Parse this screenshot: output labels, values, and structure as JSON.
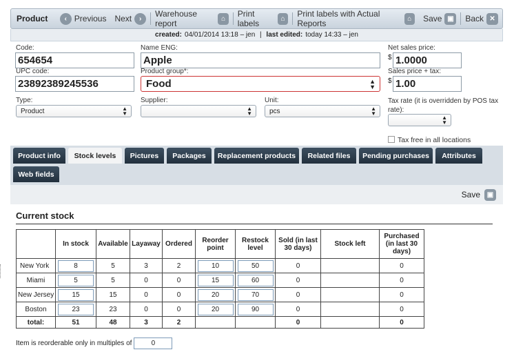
{
  "toolbar": {
    "title": "Product",
    "previous": "Previous",
    "next": "Next",
    "warehouse_report": "Warehouse report",
    "print_labels": "Print labels",
    "print_labels_actual": "Print labels with Actual Reports",
    "save": "Save",
    "back": "Back"
  },
  "meta": {
    "created_label": "created:",
    "created_value": "04/01/2014 13:18 – jen",
    "edited_label": "last edited:",
    "edited_value": "today 14:33 – jen"
  },
  "form": {
    "code_label": "Code:",
    "code_value": "654654",
    "upc_label": "UPC code:",
    "upc_value": "23892389245536",
    "name_label": "Name ENG:",
    "name_value": "Apple",
    "group_label": "Product group*:",
    "group_value": "Food",
    "net_label": "Net sales price:",
    "net_value": "1.0000",
    "gross_label": "Sales price + tax:",
    "gross_value": "1.00",
    "currency": "$",
    "type_label": "Type:",
    "type_value": "Product",
    "supplier_label": "Supplier:",
    "supplier_value": "",
    "unit_label": "Unit:",
    "unit_value": "pcs",
    "tax_label": "Tax rate (it is overridden by POS tax rate):",
    "tax_value": "",
    "taxfree_label": "Tax free in all locations"
  },
  "tabs": [
    {
      "label": "Product info"
    },
    {
      "label": "Stock levels"
    },
    {
      "label": "Pictures"
    },
    {
      "label": "Packages"
    },
    {
      "label": "Replacement products"
    },
    {
      "label": "Related files"
    },
    {
      "label": "Pending purchases"
    },
    {
      "label": "Attributes"
    },
    {
      "label": "Web fields"
    }
  ],
  "savebar": {
    "save": "Save"
  },
  "stock": {
    "title": "Current stock",
    "headers": [
      "In stock",
      "Available",
      "Layaway",
      "Ordered",
      "Reorder point",
      "Restock level",
      "Sold (in last 30 days)",
      "Stock left",
      "Purchased (in last 30 days)"
    ],
    "rows": [
      {
        "loc": "New York",
        "in": "8",
        "avail": "5",
        "lay": "3",
        "ord": "2",
        "rp": "10",
        "rl": "50",
        "sold": "0",
        "left": "",
        "pur": "0"
      },
      {
        "loc": "Miami",
        "in": "5",
        "avail": "5",
        "lay": "0",
        "ord": "0",
        "rp": "15",
        "rl": "60",
        "sold": "0",
        "left": "",
        "pur": "0"
      },
      {
        "loc": "New Jersey",
        "in": "15",
        "avail": "15",
        "lay": "0",
        "ord": "0",
        "rp": "20",
        "rl": "70",
        "sold": "0",
        "left": "",
        "pur": "0"
      },
      {
        "loc": "Boston",
        "in": "23",
        "avail": "23",
        "lay": "0",
        "ord": "0",
        "rp": "20",
        "rl": "90",
        "sold": "0",
        "left": "",
        "pur": "0"
      }
    ],
    "total": {
      "loc": "total:",
      "in": "51",
      "avail": "48",
      "lay": "3",
      "ord": "2",
      "sold": "0",
      "pur": "0"
    },
    "reorder_label": "Item is reorderable only in multiples of",
    "reorder_value": "0"
  }
}
